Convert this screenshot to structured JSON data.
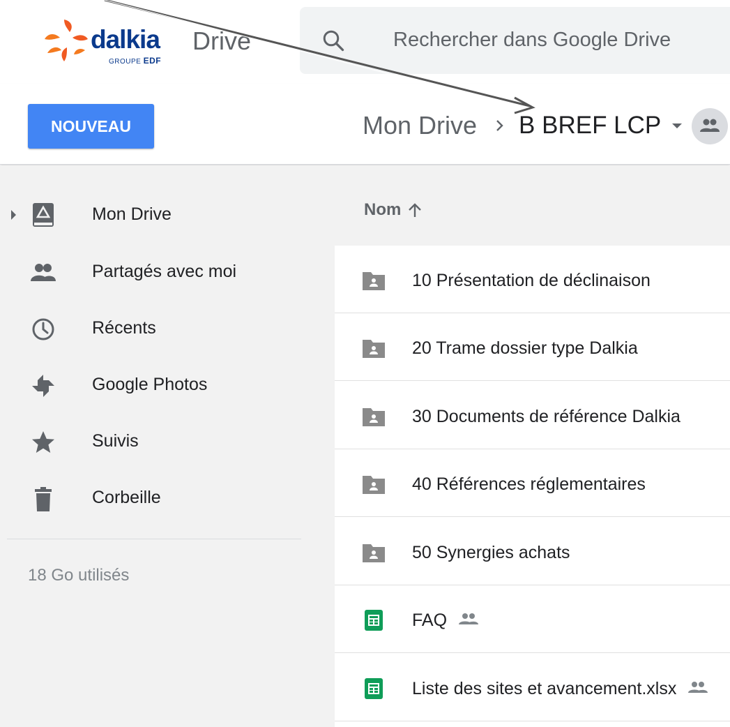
{
  "header": {
    "logo": {
      "word": "dalkia",
      "tagline_prefix": "GROUPE",
      "tagline_brand": "EDF"
    },
    "product_name": "Drive",
    "search": {
      "placeholder": "Rechercher dans Google Drive"
    }
  },
  "toolbar": {
    "new_button": "NOUVEAU",
    "breadcrumb": {
      "root": "Mon Drive",
      "current": "B BREF LCP"
    }
  },
  "sidebar": {
    "items": [
      {
        "label": "Mon Drive",
        "icon": "drive-icon"
      },
      {
        "label": "Partagés avec moi",
        "icon": "shared-people-icon"
      },
      {
        "label": "Récents",
        "icon": "clock-icon"
      },
      {
        "label": "Google Photos",
        "icon": "photos-pinwheel-icon"
      },
      {
        "label": "Suivis",
        "icon": "star-icon"
      },
      {
        "label": "Corbeille",
        "icon": "trash-icon"
      }
    ],
    "storage": "18 Go utilisés"
  },
  "file_list": {
    "column_name": "Nom",
    "rows": [
      {
        "name": "10 Présentation de déclinaison",
        "type": "shared-folder"
      },
      {
        "name": "20 Trame dossier type Dalkia",
        "type": "shared-folder"
      },
      {
        "name": "30 Documents de référence Dalkia",
        "type": "shared-folder"
      },
      {
        "name": "40 Références réglementaires",
        "type": "shared-folder"
      },
      {
        "name": "50 Synergies achats",
        "type": "shared-folder"
      },
      {
        "name": "FAQ",
        "type": "spreadsheet",
        "shared": true
      },
      {
        "name": "Liste des sites et avancement.xlsx",
        "type": "spreadsheet",
        "shared": true
      }
    ]
  },
  "colors": {
    "accent_blue": "#4285f4",
    "sidebar_bg": "#f2f2f2",
    "sheets_green": "#0f9d58",
    "folder_gray": "#8a8a8a",
    "logo_orange": "#f05a22",
    "logo_navy": "#0b3a8c"
  }
}
